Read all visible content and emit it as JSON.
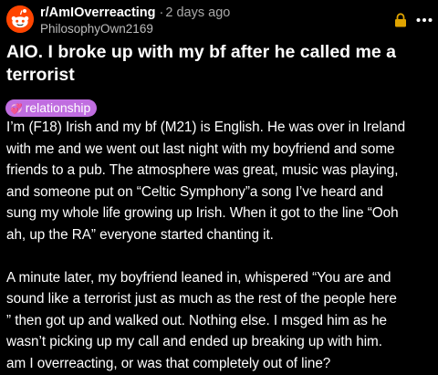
{
  "header": {
    "subreddit": "r/AmIOverreacting",
    "separator": "·",
    "time_ago": "2 days ago",
    "author": "PhilosophyOwn2169",
    "avatar_icon": "reddit-snoo-icon",
    "lock_icon": "lock-icon",
    "more_icon": "more-options-icon"
  },
  "post": {
    "title": "AIO. I broke up with my bf after he called me a terrorist",
    "flair": {
      "emoji": "💞",
      "label": "relationship",
      "color": "#c06de0"
    },
    "paragraphs": [
      "I’m (F18) Irish and my bf (M21) is English. He was over in Ireland\nwith me and we went out last night with my boyfriend and some\nfriends to a pub. The atmosphere was great, music was playing,\nand someone put on “Celtic Symphony”a song I’ve heard and\nsung my whole life growing up Irish. When it got to the line “Ooh\nah, up the RA” everyone started chanting it.",
      "A minute later, my boyfriend leaned in, whispered “You are and\nsound like a terrorist just as much as the rest of the people here\n” then got up and walked out. Nothing else. I msged him as he\nwasn’t picking up my call and ended up breaking up with him.\nam I overreacting, or was that completely out of line?"
    ]
  },
  "colors": {
    "background": "#000000",
    "text": "#ffffff",
    "muted_text": "#a8a8a8",
    "avatar_bg": "#ff4500",
    "lock_color": "#e0a400"
  }
}
